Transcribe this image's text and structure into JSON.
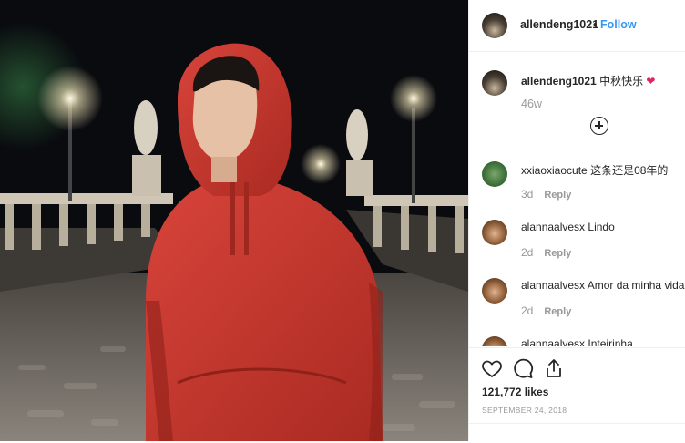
{
  "post": {
    "username": "allendeng1021",
    "follow_label": "Follow",
    "separator": "•"
  },
  "caption": {
    "username": "allendeng1021",
    "text": "中秋快乐",
    "age": "46w"
  },
  "comments": [
    {
      "username": "xxiaoxiaocute",
      "text": "这条还是08年的",
      "age": "3d",
      "reply_label": "Reply"
    },
    {
      "username": "alannaalvesx",
      "text": "Lindo",
      "age": "2d",
      "reply_label": "Reply"
    },
    {
      "username": "alannaalvesx",
      "text": "Amor da minha vida",
      "age": "2d",
      "reply_label": "Reply"
    },
    {
      "username": "alannaalvesx",
      "text": "Inteirinha"
    }
  ],
  "likes": "121,772 likes",
  "date": "SEPTEMBER 24, 2018",
  "icons": {
    "heart": "heart-icon",
    "comment": "comment-icon",
    "share": "share-icon",
    "more": "plus-circle-icon"
  },
  "colors": {
    "follow": "#3897f0",
    "hoodie": "#c8372a",
    "heart_emoji": "#e0245e"
  }
}
